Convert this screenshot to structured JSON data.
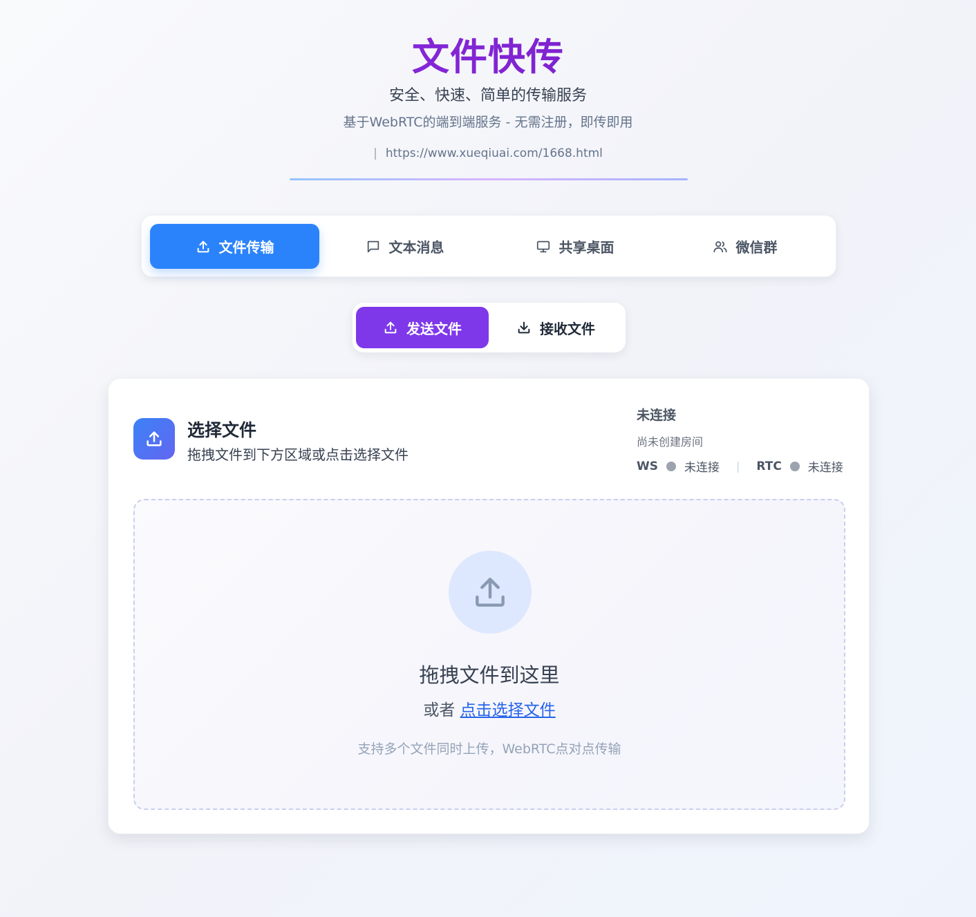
{
  "header": {
    "title": "文件快传",
    "subtitle": "安全、快速、简单的传输服务",
    "tagline": "基于WebRTC的端到端服务 - 无需注册，即传即用",
    "url_bar": "|",
    "url": "https://www.xueqiuai.com/1668.html"
  },
  "main_tabs": [
    {
      "label": "文件传输",
      "icon": "upload-icon",
      "active": true
    },
    {
      "label": "文本消息",
      "icon": "message-icon",
      "active": false
    },
    {
      "label": "共享桌面",
      "icon": "monitor-icon",
      "active": false
    },
    {
      "label": "微信群",
      "icon": "users-icon",
      "active": false
    }
  ],
  "sub_tabs": [
    {
      "label": "发送文件",
      "icon": "upload-icon",
      "active": true
    },
    {
      "label": "接收文件",
      "icon": "download-icon",
      "active": false
    }
  ],
  "card": {
    "title": "选择文件",
    "description": "拖拽文件到下方区域或点击选择文件",
    "status": {
      "main": "未连接",
      "room": "尚未创建房间",
      "ws_label": "WS",
      "ws_state": "未连接",
      "separator": "|",
      "rtc_label": "RTC",
      "rtc_state": "未连接"
    }
  },
  "dropzone": {
    "title": "拖拽文件到这里",
    "prefix": "或者",
    "link": "点击选择文件",
    "note": "支持多个文件同时上传，WebRTC点对点传输"
  },
  "colors": {
    "primary_blue": "#2b83fb",
    "primary_purple": "#7e38ea",
    "status_dot": "#9ca3af",
    "link": "#2563eb"
  }
}
